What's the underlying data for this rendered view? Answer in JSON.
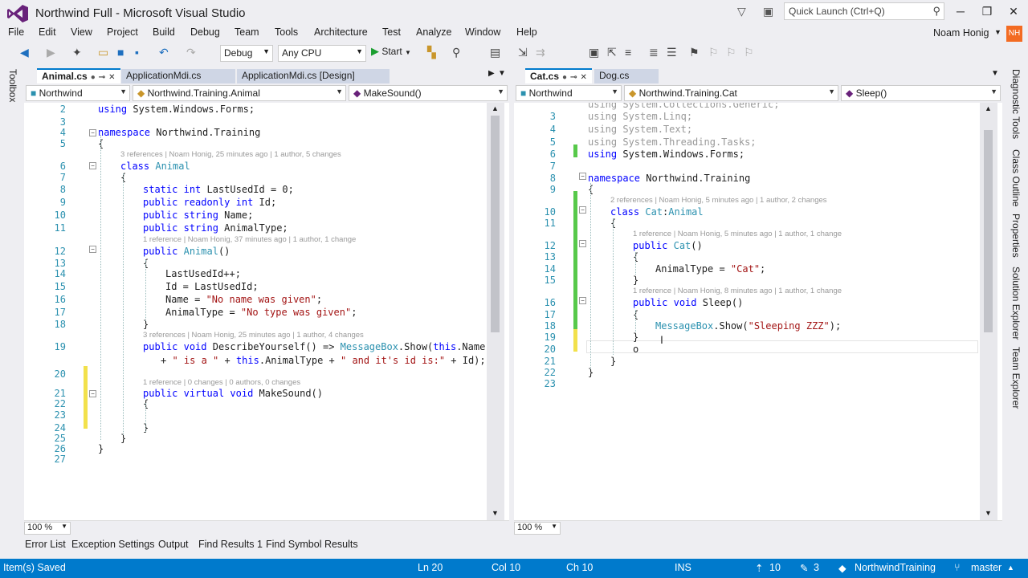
{
  "window": {
    "title": "Northwind Full - Microsoft Visual Studio",
    "quick_launch_placeholder": "Quick Launch (Ctrl+Q)",
    "user": "Noam Honig",
    "user_initials": "NH"
  },
  "menu": [
    "File",
    "Edit",
    "View",
    "Project",
    "Build",
    "Debug",
    "Team",
    "Tools",
    "Architecture",
    "Test",
    "Analyze",
    "Window",
    "Help"
  ],
  "toolbar": {
    "config": "Debug",
    "platform": "Any CPU",
    "start": "Start"
  },
  "left_strip": {
    "toolbox": "Toolbox"
  },
  "right_strip": [
    "Diagnostic Tools",
    "Class Outline",
    "Properties",
    "Solution Explorer",
    "Team Explorer"
  ],
  "left_pane": {
    "tabs": [
      {
        "label": "Animal.cs"
      },
      {
        "label": "ApplicationMdi.cs"
      },
      {
        "label": "ApplicationMdi.cs [Design]"
      }
    ],
    "nav": {
      "project": "Northwind",
      "type": "Northwind.Training.Animal",
      "member": "MakeSound()"
    },
    "zoom": "100 %",
    "lines": [
      {
        "n": "2",
        "t": "using System.Windows.Forms;"
      },
      {
        "n": "3",
        "t": ""
      },
      {
        "n": "4",
        "t": "namespace Northwind.Training"
      },
      {
        "n": "5",
        "t": "{"
      },
      {
        "lens": "3 references | Noam Honig, 25 minutes ago | 1 author, 5 changes"
      },
      {
        "n": "6",
        "t": "class Animal"
      },
      {
        "n": "7",
        "t": "{"
      },
      {
        "n": "8",
        "t": "static int LastUsedId = 0;"
      },
      {
        "n": "9",
        "t": "public readonly int Id;"
      },
      {
        "n": "10",
        "t": "public string Name;"
      },
      {
        "n": "11",
        "t": "public string AnimalType;"
      },
      {
        "lens": "1 reference | Noam Honig, 37 minutes ago | 1 author, 1 change"
      },
      {
        "n": "12",
        "t": "public Animal()"
      },
      {
        "n": "13",
        "t": "{"
      },
      {
        "n": "14",
        "t": "LastUsedId++;"
      },
      {
        "n": "15",
        "t": "Id = LastUsedId;"
      },
      {
        "n": "16",
        "t": "Name = \"No name was given\";"
      },
      {
        "n": "17",
        "t": "AnimalType = \"No type was given\";"
      },
      {
        "n": "18",
        "t": "}"
      },
      {
        "lens": "3 references | Noam Honig, 25 minutes ago | 1 author, 4 changes"
      },
      {
        "n": "19",
        "t": "public void DescribeYourself() => MessageBox.Show(this.Name"
      },
      {
        "n": "",
        "t": "+ \" is a \" + this.AnimalType + \" and it's id is:\" + Id);"
      },
      {
        "n": "20",
        "t": ""
      },
      {
        "lens": "1 reference | 0 changes | 0 authors, 0 changes"
      },
      {
        "n": "21",
        "t": "public virtual void MakeSound()"
      },
      {
        "n": "22",
        "t": "{"
      },
      {
        "n": "23",
        "t": ""
      },
      {
        "n": "24",
        "t": "}"
      },
      {
        "n": "25",
        "t": "}"
      },
      {
        "n": "26",
        "t": "}"
      },
      {
        "n": "27",
        "t": ""
      }
    ]
  },
  "right_pane": {
    "tabs": [
      {
        "label": "Cat.cs"
      },
      {
        "label": "Dog.cs"
      }
    ],
    "nav": {
      "project": "Northwind",
      "type": "Northwind.Training.Cat",
      "member": "Sleep()"
    },
    "zoom": "100 %",
    "lines": [
      {
        "n": "",
        "t": "using System.Collections.Generic;"
      },
      {
        "n": "3",
        "t": "using System.Linq;"
      },
      {
        "n": "4",
        "t": "using System.Text;"
      },
      {
        "n": "5",
        "t": "using System.Threading.Tasks;"
      },
      {
        "n": "6",
        "t": "using System.Windows.Forms;"
      },
      {
        "n": "7",
        "t": ""
      },
      {
        "n": "8",
        "t": "namespace Northwind.Training"
      },
      {
        "n": "9",
        "t": "{"
      },
      {
        "lens": "2 references | Noam Honig, 5 minutes ago | 1 author, 2 changes"
      },
      {
        "n": "10",
        "t": "class Cat:Animal"
      },
      {
        "n": "11",
        "t": "{"
      },
      {
        "lens": "1 reference | Noam Honig, 5 minutes ago | 1 author, 1 change"
      },
      {
        "n": "12",
        "t": "public Cat()"
      },
      {
        "n": "13",
        "t": "{"
      },
      {
        "n": "14",
        "t": "AnimalType = \"Cat\";"
      },
      {
        "n": "15",
        "t": "}"
      },
      {
        "lens": "1 reference | Noam Honig, 8 minutes ago | 1 author, 1 change"
      },
      {
        "n": "16",
        "t": "public void Sleep()"
      },
      {
        "n": "17",
        "t": "{"
      },
      {
        "n": "18",
        "t": "MessageBox.Show(\"Sleeping ZZZ\");"
      },
      {
        "n": "19",
        "t": "}"
      },
      {
        "n": "20",
        "t": "o"
      },
      {
        "n": "21",
        "t": "}"
      },
      {
        "n": "22",
        "t": "}"
      },
      {
        "n": "23",
        "t": ""
      }
    ]
  },
  "bottom_tabs": [
    "Error List",
    "Exception Settings",
    "Output",
    "Find Results 1",
    "Find Symbol Results"
  ],
  "status": {
    "message": "Item(s) Saved",
    "ln": "Ln 20",
    "col": "Col 10",
    "ch": "Ch 10",
    "mode": "INS",
    "commits": "10",
    "pending": "3",
    "repo": "NorthwindTraining",
    "branch": "master"
  },
  "colors": {
    "accent": "#007acc",
    "keyword": "#0000ff",
    "type": "#2b91af",
    "string": "#a31515",
    "change_saved": "#57c94a",
    "change_unsaved": "#f2e14b"
  }
}
